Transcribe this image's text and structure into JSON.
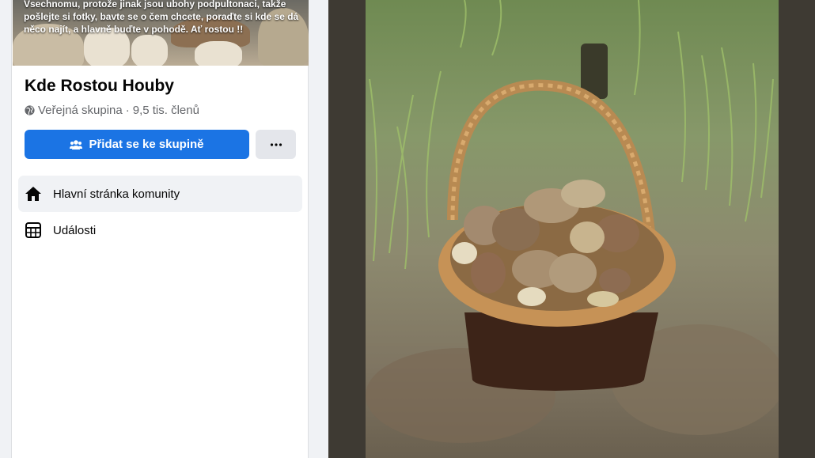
{
  "group": {
    "cover_text": "Vsechnomu, protože jinak jsou ubohy podpultonaci, takže pošlejte si fotky, bavte se o čem chcete, poraďte si kde se dá něco najít, a hlavně buďte v pohodě. Ať rostou !!",
    "name": "Kde Rostou Houby",
    "privacy": "Veřejná skupina",
    "separator": "·",
    "members": "9,5 tis. členů",
    "join_label": "Přidat se ke skupině",
    "more_label": "···"
  },
  "nav": {
    "items": [
      {
        "label": "Hlavní stránka komunity",
        "icon": "home-icon",
        "active": true
      },
      {
        "label": "Události",
        "icon": "calendar-icon",
        "active": false
      }
    ]
  },
  "colors": {
    "primary": "#1b74e4",
    "secondary_button": "#e4e6eb",
    "active_nav": "#f0f2f5",
    "viewer_bg": "#3e3a33"
  },
  "photo": {
    "subject": "wicker basket of porcini mushrooms in forest"
  }
}
